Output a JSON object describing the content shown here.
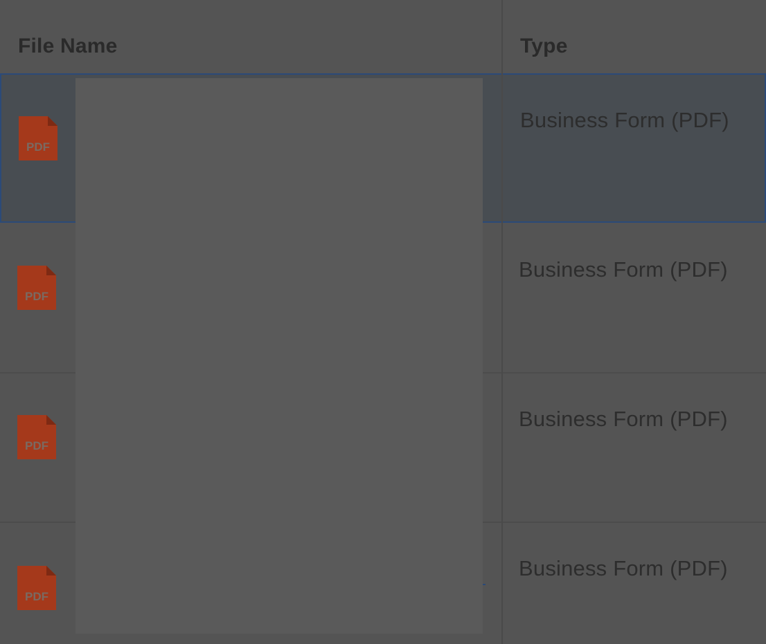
{
  "table": {
    "columns": {
      "file_name": "File Name",
      "type": "Type"
    },
    "rows": [
      {
        "icon": "pdf-file-icon",
        "icon_label": "PDF",
        "type": "Business Form (PDF)",
        "selected": true
      },
      {
        "icon": "pdf-file-icon",
        "icon_label": "PDF",
        "type": "Business Form (PDF)",
        "selected": false
      },
      {
        "icon": "pdf-file-icon",
        "icon_label": "PDF",
        "type": "Business Form (PDF)",
        "selected": false
      },
      {
        "icon": "pdf-file-icon",
        "icon_label": "PDF",
        "type": "Business Form (PDF)",
        "selected": false
      }
    ]
  },
  "colors": {
    "pdf_icon": "#a5391b",
    "selection_border": "#2b4a78",
    "overlay_background": "#545454"
  }
}
